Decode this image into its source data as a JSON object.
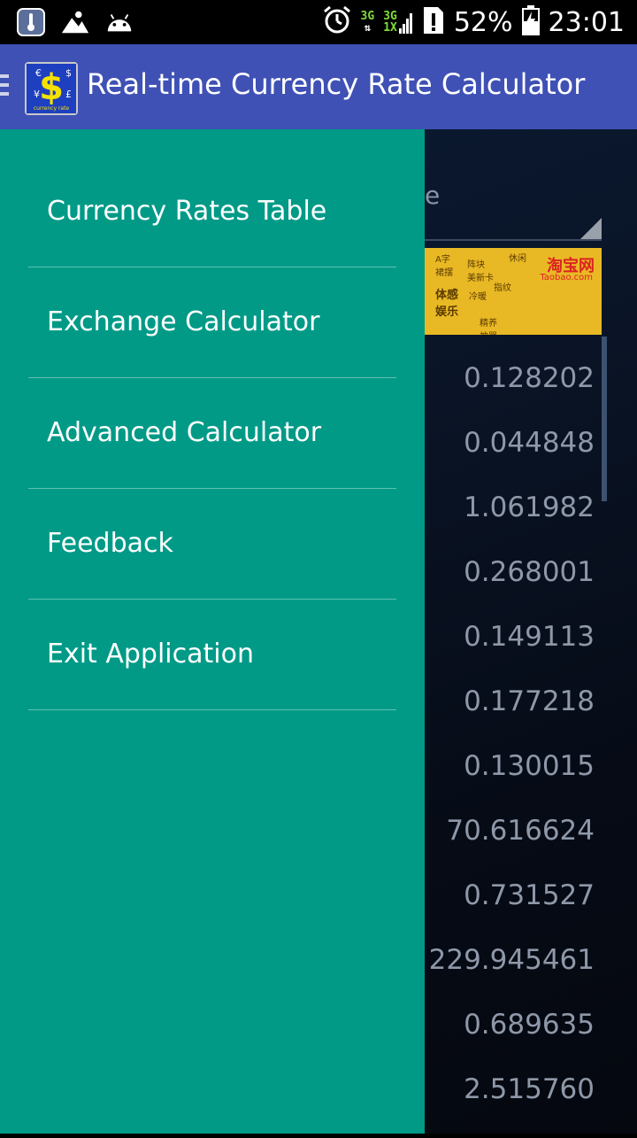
{
  "status_bar": {
    "battery": "52%",
    "time": "23:01",
    "network_top": "3G",
    "network_bottom": "1X",
    "network_top2": "3G",
    "icons": [
      "thermometer-icon",
      "weather-icon",
      "android-icon",
      "alarm-icon",
      "signal-icon",
      "sim-alert-icon",
      "battery-charging-icon"
    ]
  },
  "action_bar": {
    "title": "Real-time Currency Rate Calculator",
    "color": "#3f51b5",
    "icon_symbol": "$",
    "icon_caption": "currency rate"
  },
  "drawer": {
    "color": "#009a87",
    "items": [
      {
        "label": "Currency Rates Table"
      },
      {
        "label": "Exchange Calculator"
      },
      {
        "label": "Advanced Calculator"
      },
      {
        "label": "Feedback"
      },
      {
        "label": "Exit Application"
      }
    ]
  },
  "background": {
    "spinner_partial": "e",
    "ad": {
      "logo": "淘宝网",
      "logo_sub": "Taobao.com"
    },
    "rates": [
      "0.128202",
      "0.044848",
      "1.061982",
      "0.268001",
      "0.149113",
      "0.177218",
      "0.130015",
      "70.616624",
      "0.731527",
      "229.945461",
      "0.689635",
      "2.515760"
    ]
  }
}
